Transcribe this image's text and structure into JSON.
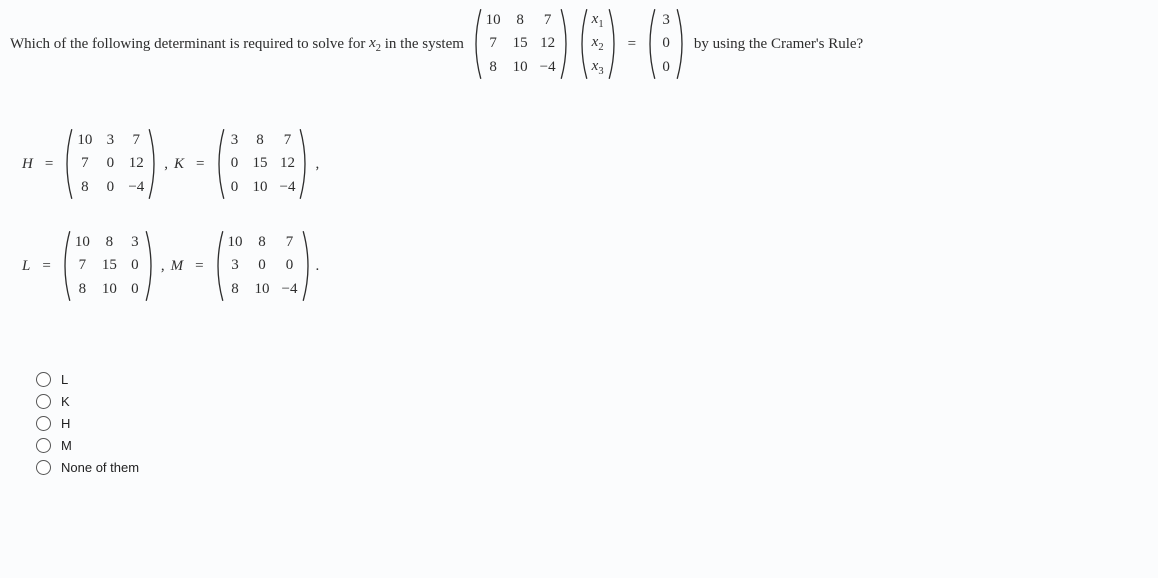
{
  "question": {
    "text_before": "Which of the following determinant is required to solve for ",
    "variable": "x",
    "variable_sub": "2",
    "text_mid": " in the system ",
    "text_after": " by using the Cramer's Rule?"
  },
  "system": {
    "A": [
      [
        "10",
        "8",
        "7"
      ],
      [
        "7",
        "15",
        "12"
      ],
      [
        "8",
        "10",
        "−4"
      ]
    ],
    "x": [
      [
        "x",
        "1"
      ],
      [
        "x",
        "2"
      ],
      [
        "x",
        "3"
      ]
    ],
    "b": [
      [
        "3"
      ],
      [
        "0"
      ],
      [
        "0"
      ]
    ],
    "equals": "="
  },
  "matrices": {
    "H": {
      "label": "H",
      "data": [
        [
          "10",
          "3",
          "7"
        ],
        [
          "7",
          "0",
          "12"
        ],
        [
          "8",
          "0",
          "−4"
        ]
      ]
    },
    "K": {
      "label": "K",
      "data": [
        [
          "3",
          "8",
          "7"
        ],
        [
          "0",
          "15",
          "12"
        ],
        [
          "0",
          "10",
          "−4"
        ]
      ]
    },
    "L": {
      "label": "L",
      "data": [
        [
          "10",
          "8",
          "3"
        ],
        [
          "7",
          "15",
          "0"
        ],
        [
          "8",
          "10",
          "0"
        ]
      ]
    },
    "M": {
      "label": "M",
      "data": [
        [
          "10",
          "8",
          "7"
        ],
        [
          "3",
          "0",
          "0"
        ],
        [
          "8",
          "10",
          "−4"
        ]
      ]
    }
  },
  "punct": {
    "comma": ",",
    "period": ".",
    "eq": "="
  },
  "options": [
    {
      "label": "L"
    },
    {
      "label": "K"
    },
    {
      "label": "H"
    },
    {
      "label": "M"
    },
    {
      "label": "None of them"
    }
  ]
}
